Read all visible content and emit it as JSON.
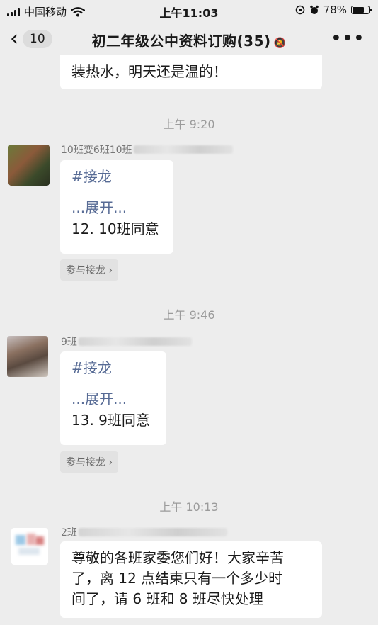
{
  "status_bar": {
    "carrier": "中国移动",
    "time": "上午11:03",
    "battery": "78%",
    "battery_level": 0.78
  },
  "nav": {
    "back_count": "10",
    "title": "初二年级公中资料订购(35)"
  },
  "messages": {
    "top_partial": "装热水，明天还是温的！",
    "stamp1": "上午 9:20",
    "m1_sender": "10班变6班10班",
    "m1_tag": "#接龙",
    "m1_expand": "...展开...",
    "m1_entry": "12. 10班同意",
    "join_label": "参与接龙",
    "stamp2": "上午 9:46",
    "m2_sender": "9班",
    "m2_tag": "#接龙",
    "m2_expand": "...展开...",
    "m2_entry": "13. 9班同意",
    "stamp3": "上午 10:13",
    "m3_sender": "2班",
    "m3_line1": "尊敬的各班家委您们好！大家辛苦",
    "m3_line2": "了，离 12 点结束只有一个多少时",
    "m3_line3": "间了，请 6 班和 8 班尽快处理"
  },
  "icons": {
    "back": "chevron-left-icon",
    "mute": "bell-off-icon",
    "more": "more-dots-icon",
    "wifi": "wifi-icon",
    "signal": "signal-icon",
    "battery": "battery-icon"
  }
}
